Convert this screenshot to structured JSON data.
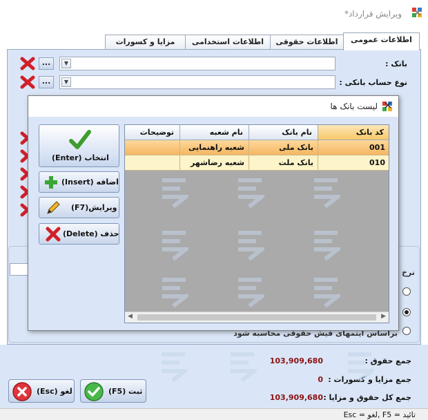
{
  "window": {
    "title": "ویرایش قرارداد*",
    "close": "✕"
  },
  "tabs": [
    {
      "label": "اطلاعات عمومی"
    },
    {
      "label": "اطلاعات حقوقی"
    },
    {
      "label": "اطلاعات استخدامی"
    },
    {
      "label": "مزایا و کسورات"
    }
  ],
  "form": {
    "bank_label": "بانک :",
    "account_type_label": "نوع حساب بانکی :",
    "dots": "...",
    "rate_label_partial": "نرخ",
    "option_partial": "براساس ایتمهای فیش حقوقی محاسبه شود"
  },
  "totals": {
    "salary_label": "جمع حقوق :",
    "salary_value": "103,909,680",
    "benefits_label": "جمع مزایا و کسورات :",
    "benefits_value": "0",
    "total_label": "جمع کل حقوق و مزایا :",
    "total_value": "103,909,680"
  },
  "buttons": {
    "submit": "ثبت (F5)",
    "cancel": "لغو (Esc)"
  },
  "status": {
    "text": "تائید = F5   ,لغو = Esc"
  },
  "dialog": {
    "title": "لیست بانک ها",
    "close": "✕",
    "select": "انتخاب (Enter)",
    "add": "اضافه (Insert)",
    "edit": "ویرایش(F7)",
    "delete": "حذف (Delete)",
    "columns": [
      "کد بانک",
      "نام بانک",
      "نام شعبه",
      "توضیحات"
    ],
    "rows": [
      [
        "001",
        "بانک ملی",
        "شعبه راهنمایی",
        ""
      ],
      [
        "010",
        "بانک ملت",
        "شعبه رضاشهر",
        ""
      ]
    ]
  },
  "colors": {
    "panel_bg": "#dae6f7",
    "value_red": "#8b1111",
    "row_selected": "#f4b560",
    "row_alt": "#fdf4c9"
  }
}
